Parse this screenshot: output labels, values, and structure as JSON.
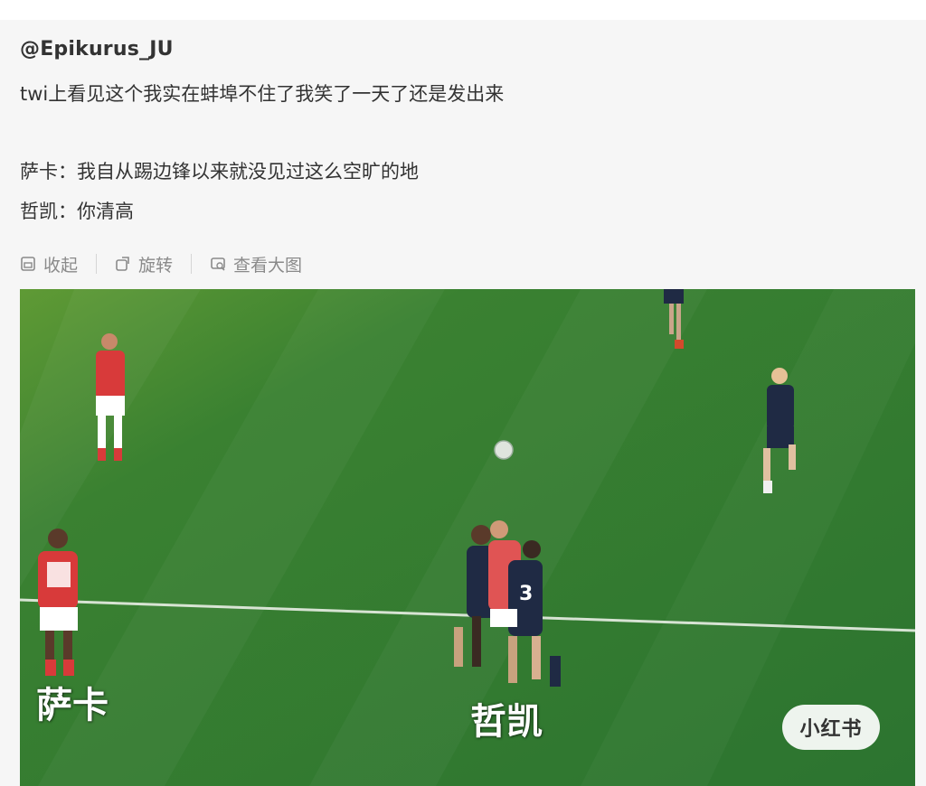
{
  "post": {
    "author": "@Epikurus_JU",
    "line1": "twi上看见这个我实在蚌埠不住了我笑了一天了还是发出来",
    "line2": "萨卡：我自从踢边锋以来就没见过这么空旷的地",
    "line3": "哲凯：你清高"
  },
  "toolbar": {
    "collapse_label": "收起",
    "rotate_label": "旋转",
    "view_large_label": "查看大图",
    "collapse_icon": "collapse-icon",
    "rotate_icon": "rotate-icon",
    "view_large_icon": "view-large-icon"
  },
  "image": {
    "caption_left": "萨卡",
    "caption_right": "哲凯",
    "watermark": "小红书"
  },
  "colors": {
    "pitch_green": "#2f7a2c",
    "home_kit_red": "#d83a3a",
    "away_kit_navy": "#1f2a44"
  }
}
